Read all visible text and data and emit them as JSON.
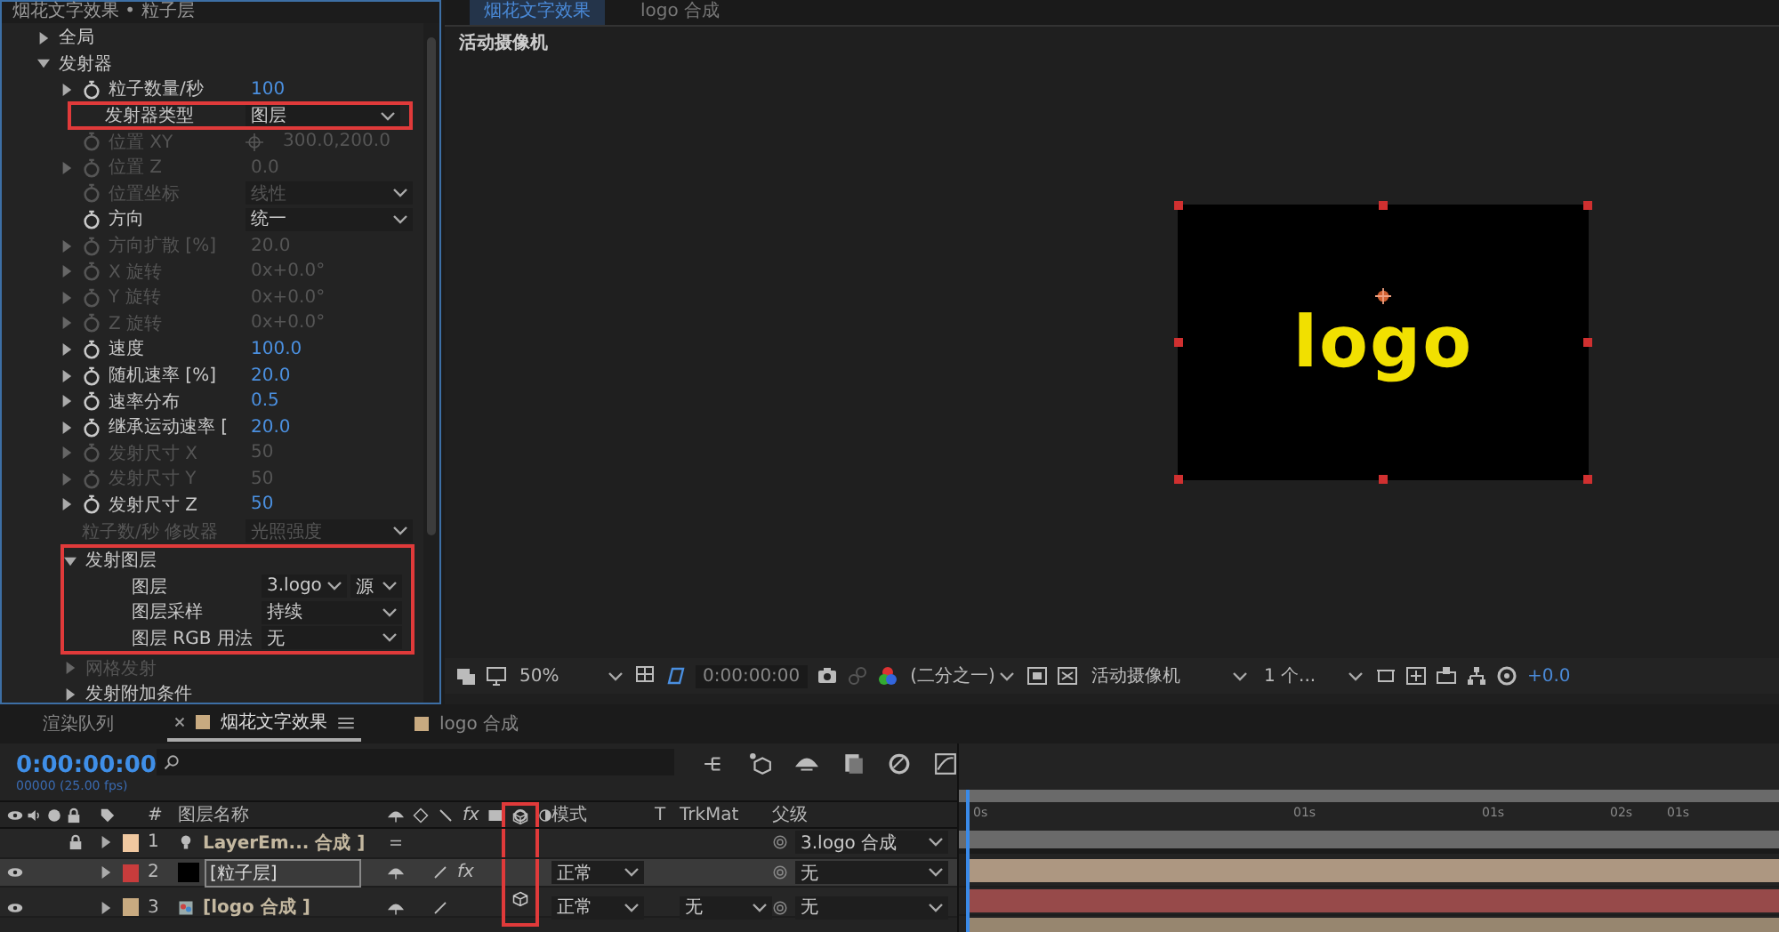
{
  "effect_controls": {
    "title": "烟花文字效果 • 粒子层",
    "groups": [
      {
        "kind": "section",
        "label": "全局",
        "expanded": false,
        "highlighted": false,
        "disabled": false
      },
      {
        "kind": "section",
        "label": "发射器",
        "expanded": true,
        "highlighted": false,
        "disabled": false,
        "children": [
          {
            "kind": "number",
            "label": "粒子数量/秒",
            "twirl": true,
            "stopwatch": true,
            "disabled": false,
            "highlighted": false,
            "value": "100"
          },
          {
            "kind": "dropdown",
            "label": "发射器类型",
            "twirl": false,
            "stopwatch": false,
            "disabled": false,
            "highlighted": true,
            "values": [
              "图层"
            ]
          },
          {
            "kind": "point",
            "label": "位置 XY",
            "twirl": false,
            "stopwatch": true,
            "disabled": true,
            "highlighted": false,
            "value": "300.0,200.0"
          },
          {
            "kind": "number",
            "label": "位置 Z",
            "twirl": true,
            "stopwatch": true,
            "disabled": true,
            "highlighted": false,
            "value": "0.0"
          },
          {
            "kind": "dropdown",
            "label": "位置坐标",
            "twirl": false,
            "stopwatch": true,
            "disabled": true,
            "highlighted": false,
            "values": [
              "线性"
            ]
          },
          {
            "kind": "dropdown",
            "label": "方向",
            "twirl": false,
            "stopwatch": true,
            "disabled": false,
            "highlighted": false,
            "values": [
              "统一"
            ]
          },
          {
            "kind": "number",
            "label": "方向扩散 [%]",
            "twirl": true,
            "stopwatch": true,
            "disabled": true,
            "highlighted": false,
            "value": "20.0"
          },
          {
            "kind": "number",
            "label": "X 旋转",
            "twirl": true,
            "stopwatch": true,
            "disabled": true,
            "highlighted": false,
            "value": "0x+0.0°"
          },
          {
            "kind": "number",
            "label": "Y 旋转",
            "twirl": true,
            "stopwatch": true,
            "disabled": true,
            "highlighted": false,
            "value": "0x+0.0°"
          },
          {
            "kind": "number",
            "label": "Z 旋转",
            "twirl": true,
            "stopwatch": true,
            "disabled": true,
            "highlighted": false,
            "value": "0x+0.0°"
          },
          {
            "kind": "number",
            "label": "速度",
            "twirl": true,
            "stopwatch": true,
            "disabled": false,
            "highlighted": false,
            "value": "100.0"
          },
          {
            "kind": "number",
            "label": "随机速率 [%]",
            "twirl": true,
            "stopwatch": true,
            "disabled": false,
            "highlighted": false,
            "value": "20.0"
          },
          {
            "kind": "number",
            "label": "速率分布",
            "twirl": true,
            "stopwatch": true,
            "disabled": false,
            "highlighted": false,
            "value": "0.5"
          },
          {
            "kind": "number",
            "label": "继承运动速率 [",
            "twirl": true,
            "stopwatch": true,
            "disabled": false,
            "highlighted": false,
            "value": "20.0"
          },
          {
            "kind": "number",
            "label": "发射尺寸 X",
            "twirl": true,
            "stopwatch": true,
            "disabled": true,
            "highlighted": false,
            "value": "50"
          },
          {
            "kind": "number",
            "label": "发射尺寸 Y",
            "twirl": true,
            "stopwatch": true,
            "disabled": true,
            "highlighted": false,
            "value": "50"
          },
          {
            "kind": "number",
            "label": "发射尺寸 Z",
            "twirl": true,
            "stopwatch": true,
            "disabled": false,
            "highlighted": false,
            "value": "50"
          },
          {
            "kind": "dropdown",
            "label": "粒子数/秒 修改器",
            "twirl": false,
            "stopwatch": false,
            "disabled": true,
            "highlighted": false,
            "values": [
              "光照强度"
            ]
          }
        ]
      },
      {
        "kind": "subsection",
        "label": "发射图层",
        "expanded": true,
        "highlighted": true,
        "disabled": false,
        "children": [
          {
            "kind": "dropdown",
            "label": "图层",
            "twirl": false,
            "stopwatch": false,
            "disabled": false,
            "highlighted": false,
            "values": [
              "3.logo",
              "源"
            ]
          },
          {
            "kind": "dropdown",
            "label": "图层采样",
            "twirl": false,
            "stopwatch": false,
            "disabled": false,
            "highlighted": false,
            "values": [
              "持续"
            ]
          },
          {
            "kind": "dropdown",
            "label": "图层 RGB 用法",
            "twirl": false,
            "stopwatch": false,
            "disabled": false,
            "highlighted": false,
            "values": [
              "无"
            ]
          }
        ]
      },
      {
        "kind": "subsection",
        "label": "网格发射",
        "expanded": false,
        "highlighted": false,
        "disabled": true
      },
      {
        "kind": "subsection",
        "label": "发射附加条件",
        "expanded": false,
        "highlighted": false,
        "disabled": false
      }
    ]
  },
  "viewer": {
    "tabs": [
      {
        "label": "烟花文字效果",
        "selected": true
      },
      {
        "label": "logo 合成",
        "selected": false
      }
    ],
    "camera_label": "活动摄像机",
    "comp_text": "logo",
    "toolbar": {
      "zoom": "50%",
      "timecode": "0:00:00:00",
      "resolution": "(二分之一)",
      "camera": "活动摄像机",
      "views": "1 个...",
      "exposure": "+0.0"
    }
  },
  "timeline": {
    "tabs": [
      {
        "label": "渲染队列",
        "selected": false,
        "kind": "queue"
      },
      {
        "label": "烟花文字效果",
        "selected": true,
        "kind": "composition"
      },
      {
        "label": "logo 合成",
        "selected": false,
        "kind": "composition"
      }
    ],
    "timecode": "0:00:00:00",
    "fps": "00000 (25.00 fps)",
    "columns": [
      {
        "kind": "number",
        "label": "#"
      },
      {
        "kind": "name",
        "label": "图层名称"
      },
      {
        "kind": "effects",
        "label": "fx"
      },
      {
        "kind": "mode",
        "label": "模式"
      },
      {
        "kind": "t",
        "label": "T"
      },
      {
        "kind": "trkmat",
        "label": "TrkMat"
      },
      {
        "kind": "parent",
        "label": "父级"
      }
    ],
    "threed_column_annotated": true,
    "layers": [
      {
        "index": "1",
        "name": "LayerEm... 合成 ]",
        "kind": "light",
        "color": "#f0c8a0",
        "visible": false,
        "locked": true,
        "selected": false,
        "threed": false,
        "parent": "3.logo 合成"
      },
      {
        "index": "2",
        "name": "[粒子层]",
        "kind": "solid",
        "color": "#c83c3c",
        "visible": true,
        "locked": false,
        "selected": true,
        "threed": false,
        "fx": "fx",
        "mode": "正常",
        "parent": "无"
      },
      {
        "index": "3",
        "name": "[logo 合成 ]",
        "kind": "comp",
        "color": "#c8aa80",
        "visible": true,
        "locked": false,
        "selected": false,
        "threed": true,
        "mode": "正常",
        "trkmat": "无",
        "parent": "无"
      }
    ],
    "ruler": [
      "0s",
      "01s",
      "01s",
      "02s",
      "01s"
    ]
  }
}
